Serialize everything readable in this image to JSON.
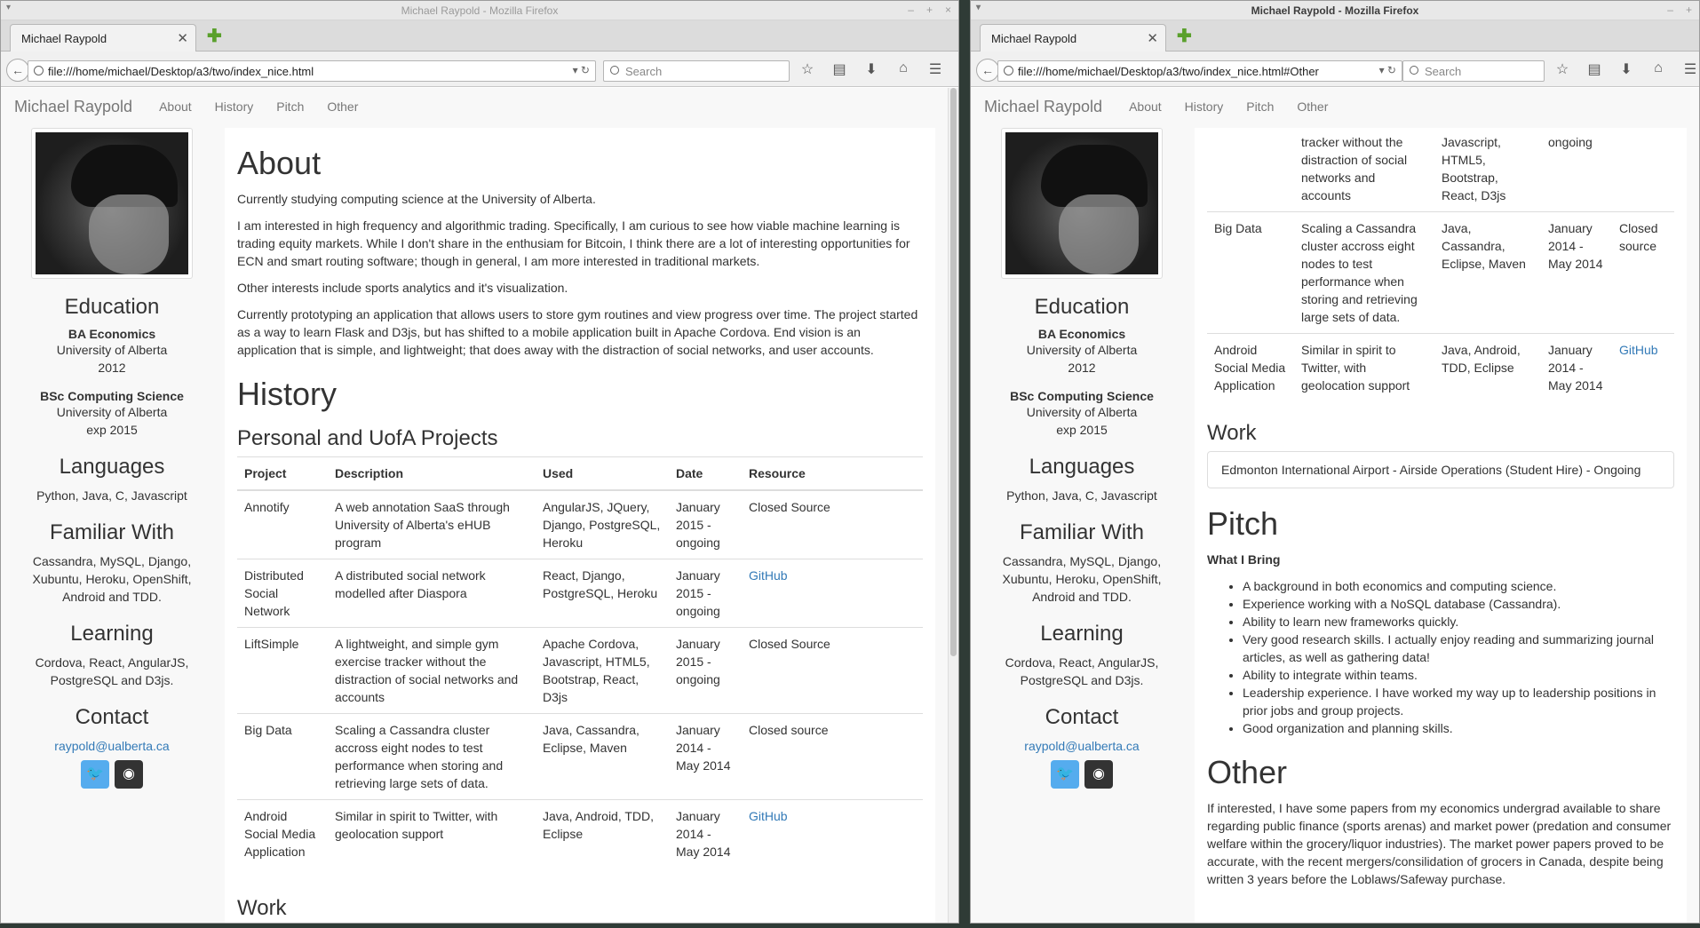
{
  "windows": [
    {
      "title": "Michael Raypold - Mozilla Firefox",
      "tab_title": "Michael Raypold",
      "url": "file:///home/michael/Desktop/a3/two/index_nice.html",
      "search_placeholder": "Search"
    },
    {
      "title": "Michael Raypold - Mozilla Firefox",
      "tab_title": "Michael Raypold",
      "url": "file:///home/michael/Desktop/a3/two/index_nice.html#Other",
      "search_placeholder": "Search"
    }
  ],
  "site": {
    "brand": "Michael Raypold",
    "nav": [
      "About",
      "History",
      "Pitch",
      "Other"
    ]
  },
  "sidebar": {
    "education_heading": "Education",
    "degrees": [
      {
        "name": "BA Economics",
        "school": "University of Alberta",
        "year": "2012"
      },
      {
        "name": "BSc Computing Science",
        "school": "University of Alberta",
        "year": "exp 2015"
      }
    ],
    "languages_heading": "Languages",
    "languages": "Python, Java, C, Javascript",
    "familiar_heading": "Familiar With",
    "familiar": [
      "Cassandra, MySQL, Django,",
      "Xubuntu, Heroku, OpenShift,",
      "Android and TDD."
    ],
    "learning_heading": "Learning",
    "learning": [
      "Cordova, React, AngularJS,",
      "PostgreSQL and D3js."
    ],
    "contact_heading": "Contact",
    "email": "raypold@ualberta.ca"
  },
  "about": {
    "heading": "About",
    "paragraphs": [
      "Currently studying computing science at the University of Alberta.",
      "I am interested in high frequency and algorithmic trading. Specifically, I am curious to see how viable machine learning is trading equity markets. While I don't share in the enthusiam for Bitcoin, I think there are a lot of interesting opportunities for ECN and smart routing software; though in general, I am more interested in traditional markets.",
      "Other interests include sports analytics and it's visualization.",
      "Currently prototyping an application that allows users to store gym routines and view progress over time. The project started as a way to learn Flask and D3js, but has shifted to a mobile application built in Apache Cordova. End vision is an application that is simple, and lightweight; that does away with the distraction of social networks, and user accounts."
    ]
  },
  "history": {
    "heading": "History",
    "subheading": "Personal and UofA Projects",
    "columns": [
      "Project",
      "Description",
      "Used",
      "Date",
      "Resource"
    ],
    "rows": [
      {
        "project": "Annotify",
        "description": "A web annotation SaaS through University of Alberta's eHUB program",
        "used": "AngularJS, JQuery, Django, PostgreSQL, Heroku",
        "date": "January 2015 - ongoing",
        "resource": "Closed Source",
        "link": false
      },
      {
        "project": "Distributed Social Network",
        "description": "A distributed social network modelled after Diaspora",
        "used": "React, Django, PostgreSQL, Heroku",
        "date": "January 2015 - ongoing",
        "resource": "GitHub",
        "link": true
      },
      {
        "project": "LiftSimple",
        "description": "A lightweight, and simple gym exercise tracker without the distraction of social networks and accounts",
        "used": "Apache Cordova, Javascript, HTML5, Bootstrap, React, D3js",
        "date": "January 2015 - ongoing",
        "resource": "Closed Source",
        "link": false
      },
      {
        "project": "Big Data",
        "description": "Scaling a Cassandra cluster accross eight nodes to test performance when storing and retrieving large sets of data.",
        "used": "Java, Cassandra, Eclipse, Maven",
        "date": "January 2014 - May 2014",
        "resource": "Closed source",
        "link": false
      },
      {
        "project": "Android Social Media Application",
        "description": "Similar in spirit to Twitter, with geolocation support",
        "used": "Java, Android, TDD, Eclipse",
        "date": "January 2014 - May 2014",
        "resource": "GitHub",
        "link": true
      }
    ],
    "right_partial_row": {
      "description": "tracker without the distraction of social networks and accounts",
      "used": "Javascript, HTML5, Bootstrap, React, D3js",
      "date": "ongoing"
    },
    "work_heading": "Work",
    "work_item": "Edmonton International Airport - Airside Operations (Student Hire) - Ongoing"
  },
  "pitch": {
    "heading": "Pitch",
    "subheading": "What I Bring",
    "items": [
      "A background in both economics and computing science.",
      "Experience working with a NoSQL database (Cassandra).",
      "Ability to learn new frameworks quickly.",
      "Very good research skills. I actually enjoy reading and summarizing journal articles, as well as gathering data!",
      "Ability to integrate within teams.",
      "Leadership experience. I have worked my way up to leadership positions in prior jobs and group projects.",
      "Good organization and planning skills."
    ]
  },
  "other": {
    "heading": "Other",
    "paragraph": "If interested, I have some papers from my economics undergrad available to share regarding public finance (sports arenas) and market power (predation and consumer welfare within the grocery/liquor industries). The market power papers proved to be accurate, with the recent mergers/consilidation of grocers in Canada, despite being written 3 years before the Loblaws/Safeway purchase."
  }
}
